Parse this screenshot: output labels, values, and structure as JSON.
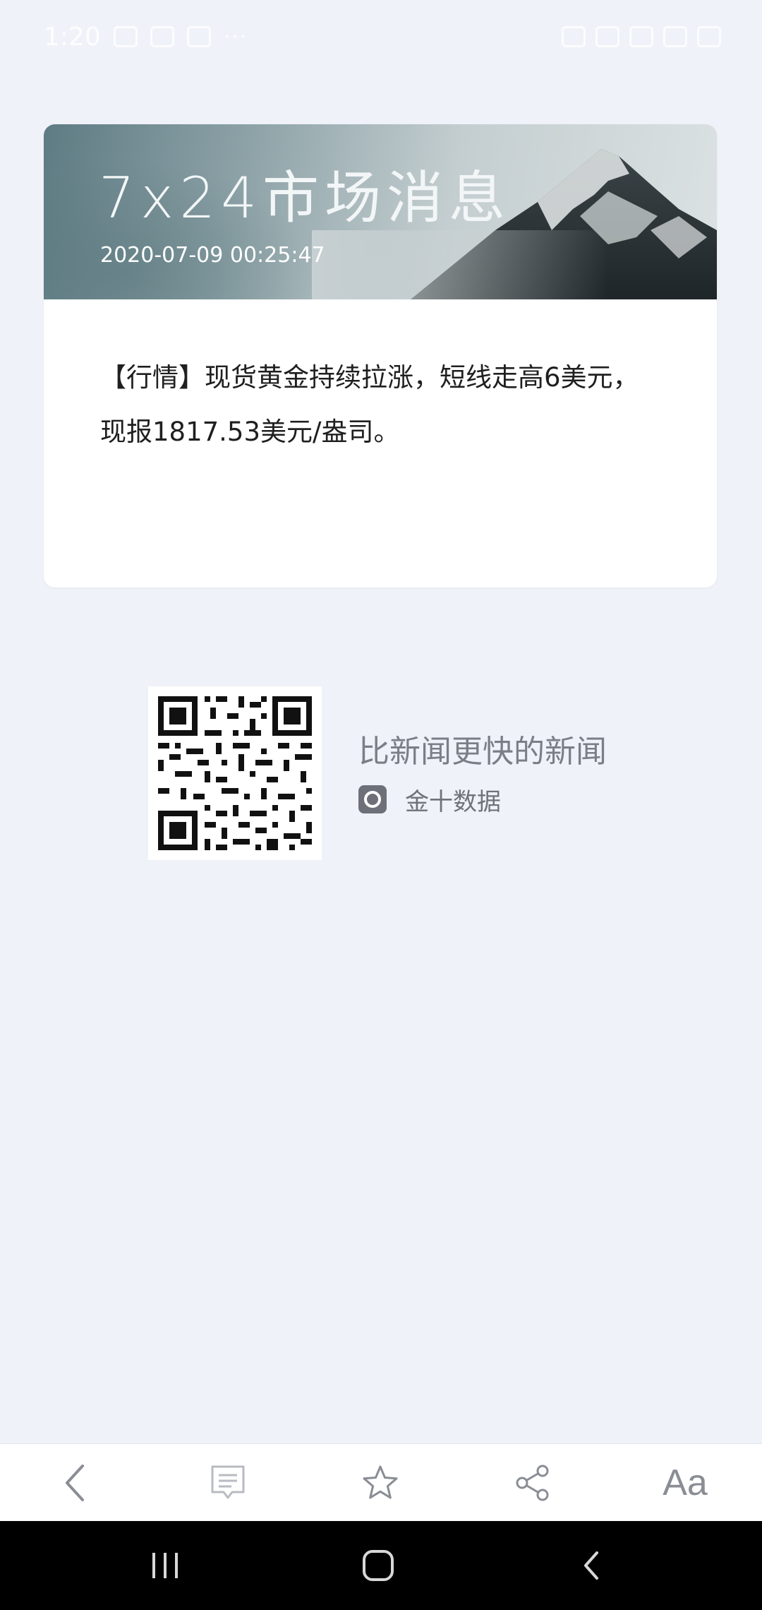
{
  "status_bar": {
    "time": "1:20",
    "extra": "···"
  },
  "card": {
    "banner_title": "7x24市场消息",
    "timestamp": "2020-07-09 00:25:47",
    "content": "【行情】现货黄金持续拉涨，短线走高6美元，现报1817.53美元/盎司。"
  },
  "promo": {
    "slogan": "比新闻更快的新闻",
    "brand": "金十数据"
  },
  "toolbar": {
    "back_icon": "chevron-left-icon",
    "comment_icon": "comment-icon",
    "favorite_icon": "star-icon",
    "share_icon": "share-icon",
    "font_size_label": "Aa"
  },
  "nav": {
    "recents_icon": "recents-icon",
    "home_icon": "home-icon",
    "back_icon": "back-icon"
  }
}
